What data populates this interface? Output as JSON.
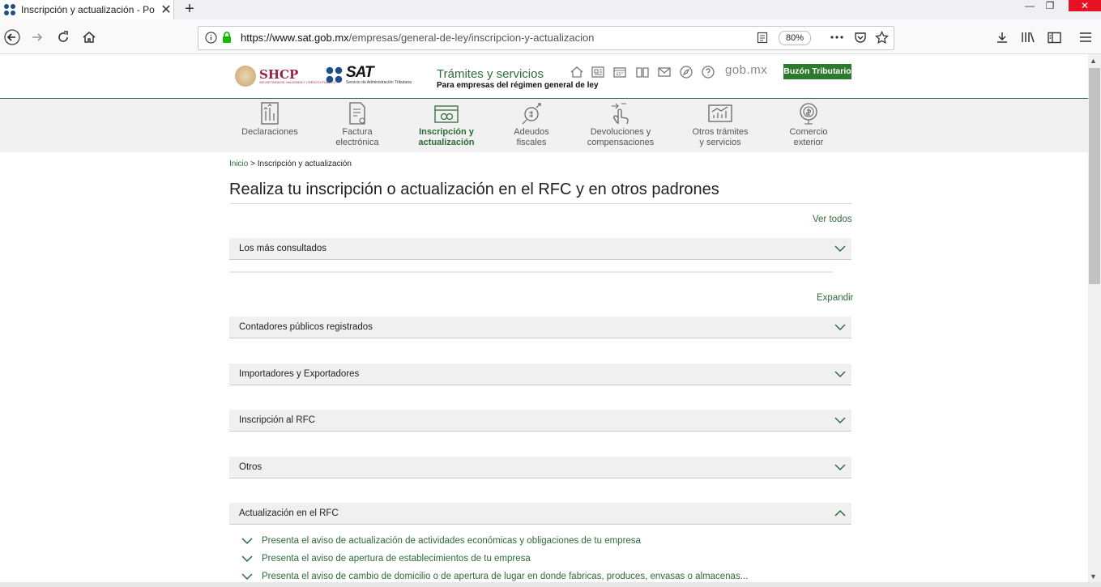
{
  "browser": {
    "tab_title": "Inscripción y actualización - Po",
    "url_host": "https://www.sat.gob.mx",
    "url_path": "/empresas/general-de-ley/inscripcion-y-actualizacion",
    "zoom": "80%",
    "icons": [
      "back-icon",
      "forward-icon",
      "reload-icon",
      "home-icon",
      "info-icon",
      "lock-icon",
      "reader-view-icon",
      "more-icon",
      "pocket-icon",
      "bookmark-star-icon",
      "download-icon",
      "library-icon",
      "sidebar-icon",
      "menu-icon"
    ]
  },
  "header": {
    "shcp_title": "SHCP",
    "shcp_sub": "SECRETARÍA DE HACIENDA Y CRÉDITO PÚBLICO",
    "sat_title": "SAT",
    "sat_sub": "Servicio de Administración Tributaria",
    "tramites": "Trámites y servicios",
    "tramites_sub": "Para empresas del régimen general de ley",
    "gobmx": "gob.mx",
    "buzon": "Buzón Tributario",
    "accent": "#2d6b3a"
  },
  "menu": [
    {
      "line1": "Declaraciones",
      "line2": ""
    },
    {
      "line1": "Factura",
      "line2": "electrónica"
    },
    {
      "line1": "Inscripción y",
      "line2": "actualización"
    },
    {
      "line1": "Adeudos",
      "line2": "fiscales"
    },
    {
      "line1": "Devoluciones y",
      "line2": "compensaciones"
    },
    {
      "line1": "Otros trámites",
      "line2": "y servicios"
    },
    {
      "line1": "Comercio",
      "line2": "exterior"
    }
  ],
  "content": {
    "breadcrumb_home": "Inicio",
    "breadcrumb_sep": ">",
    "breadcrumb_current": "Inscripción y actualización",
    "title": "Realiza tu inscripción o actualización en el RFC y en otros padrones",
    "ver_todos": "Ver todos",
    "expandir": "Expandir",
    "most_consulted": "Los más consultados",
    "sections": [
      "Contadores públicos registrados",
      "Importadores y Exportadores",
      "Inscripción al RFC",
      "Otros",
      "Actualización en el RFC"
    ],
    "subitems": [
      "Presenta el aviso de actualización de actividades económicas y obligaciones de tu empresa",
      "Presenta el aviso de apertura de establecimientos de tu empresa",
      "Presenta el aviso de cambio de domicilio o de apertura de lugar en donde fabricas, produces, envasas o almacenas..."
    ]
  }
}
